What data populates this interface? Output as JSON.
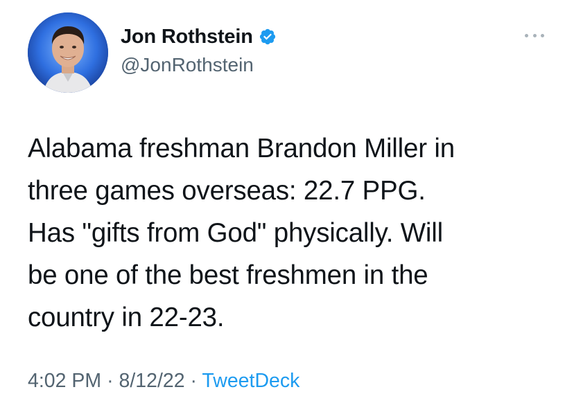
{
  "author": {
    "display_name": "Jon Rothstein",
    "handle": "@JonRothstein",
    "verified": true,
    "verified_icon": "verified-badge-icon",
    "avatar_icon": "profile-photo"
  },
  "more_icon": "ellipsis-icon",
  "tweet": {
    "text_lines": [
      "Alabama freshman Brandon Miller in",
      "three games overseas: 22.7 PPG.",
      "Has \"gifts from God\" physically. Will",
      "be one of the best freshmen in the",
      "country in 22-23."
    ]
  },
  "meta": {
    "time": "4:02 PM",
    "separator": "·",
    "date": "8/12/22",
    "source": "TweetDeck"
  },
  "colors": {
    "text": "#0f1419",
    "secondary": "#536471",
    "accent": "#1d9bf0"
  }
}
